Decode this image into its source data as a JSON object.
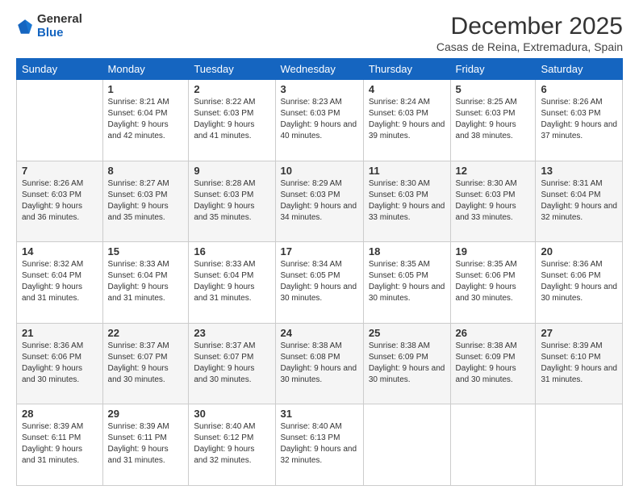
{
  "header": {
    "logo_general": "General",
    "logo_blue": "Blue",
    "main_title": "December 2025",
    "subtitle": "Casas de Reina, Extremadura, Spain"
  },
  "days_of_week": [
    "Sunday",
    "Monday",
    "Tuesday",
    "Wednesday",
    "Thursday",
    "Friday",
    "Saturday"
  ],
  "weeks": [
    [
      {
        "day": "",
        "sunrise": "",
        "sunset": "",
        "daylight": ""
      },
      {
        "day": "1",
        "sunrise": "Sunrise: 8:21 AM",
        "sunset": "Sunset: 6:04 PM",
        "daylight": "Daylight: 9 hours and 42 minutes."
      },
      {
        "day": "2",
        "sunrise": "Sunrise: 8:22 AM",
        "sunset": "Sunset: 6:03 PM",
        "daylight": "Daylight: 9 hours and 41 minutes."
      },
      {
        "day": "3",
        "sunrise": "Sunrise: 8:23 AM",
        "sunset": "Sunset: 6:03 PM",
        "daylight": "Daylight: 9 hours and 40 minutes."
      },
      {
        "day": "4",
        "sunrise": "Sunrise: 8:24 AM",
        "sunset": "Sunset: 6:03 PM",
        "daylight": "Daylight: 9 hours and 39 minutes."
      },
      {
        "day": "5",
        "sunrise": "Sunrise: 8:25 AM",
        "sunset": "Sunset: 6:03 PM",
        "daylight": "Daylight: 9 hours and 38 minutes."
      },
      {
        "day": "6",
        "sunrise": "Sunrise: 8:26 AM",
        "sunset": "Sunset: 6:03 PM",
        "daylight": "Daylight: 9 hours and 37 minutes."
      }
    ],
    [
      {
        "day": "7",
        "sunrise": "Sunrise: 8:26 AM",
        "sunset": "Sunset: 6:03 PM",
        "daylight": "Daylight: 9 hours and 36 minutes."
      },
      {
        "day": "8",
        "sunrise": "Sunrise: 8:27 AM",
        "sunset": "Sunset: 6:03 PM",
        "daylight": "Daylight: 9 hours and 35 minutes."
      },
      {
        "day": "9",
        "sunrise": "Sunrise: 8:28 AM",
        "sunset": "Sunset: 6:03 PM",
        "daylight": "Daylight: 9 hours and 35 minutes."
      },
      {
        "day": "10",
        "sunrise": "Sunrise: 8:29 AM",
        "sunset": "Sunset: 6:03 PM",
        "daylight": "Daylight: 9 hours and 34 minutes."
      },
      {
        "day": "11",
        "sunrise": "Sunrise: 8:30 AM",
        "sunset": "Sunset: 6:03 PM",
        "daylight": "Daylight: 9 hours and 33 minutes."
      },
      {
        "day": "12",
        "sunrise": "Sunrise: 8:30 AM",
        "sunset": "Sunset: 6:03 PM",
        "daylight": "Daylight: 9 hours and 33 minutes."
      },
      {
        "day": "13",
        "sunrise": "Sunrise: 8:31 AM",
        "sunset": "Sunset: 6:04 PM",
        "daylight": "Daylight: 9 hours and 32 minutes."
      }
    ],
    [
      {
        "day": "14",
        "sunrise": "Sunrise: 8:32 AM",
        "sunset": "Sunset: 6:04 PM",
        "daylight": "Daylight: 9 hours and 31 minutes."
      },
      {
        "day": "15",
        "sunrise": "Sunrise: 8:33 AM",
        "sunset": "Sunset: 6:04 PM",
        "daylight": "Daylight: 9 hours and 31 minutes."
      },
      {
        "day": "16",
        "sunrise": "Sunrise: 8:33 AM",
        "sunset": "Sunset: 6:04 PM",
        "daylight": "Daylight: 9 hours and 31 minutes."
      },
      {
        "day": "17",
        "sunrise": "Sunrise: 8:34 AM",
        "sunset": "Sunset: 6:05 PM",
        "daylight": "Daylight: 9 hours and 30 minutes."
      },
      {
        "day": "18",
        "sunrise": "Sunrise: 8:35 AM",
        "sunset": "Sunset: 6:05 PM",
        "daylight": "Daylight: 9 hours and 30 minutes."
      },
      {
        "day": "19",
        "sunrise": "Sunrise: 8:35 AM",
        "sunset": "Sunset: 6:06 PM",
        "daylight": "Daylight: 9 hours and 30 minutes."
      },
      {
        "day": "20",
        "sunrise": "Sunrise: 8:36 AM",
        "sunset": "Sunset: 6:06 PM",
        "daylight": "Daylight: 9 hours and 30 minutes."
      }
    ],
    [
      {
        "day": "21",
        "sunrise": "Sunrise: 8:36 AM",
        "sunset": "Sunset: 6:06 PM",
        "daylight": "Daylight: 9 hours and 30 minutes."
      },
      {
        "day": "22",
        "sunrise": "Sunrise: 8:37 AM",
        "sunset": "Sunset: 6:07 PM",
        "daylight": "Daylight: 9 hours and 30 minutes."
      },
      {
        "day": "23",
        "sunrise": "Sunrise: 8:37 AM",
        "sunset": "Sunset: 6:07 PM",
        "daylight": "Daylight: 9 hours and 30 minutes."
      },
      {
        "day": "24",
        "sunrise": "Sunrise: 8:38 AM",
        "sunset": "Sunset: 6:08 PM",
        "daylight": "Daylight: 9 hours and 30 minutes."
      },
      {
        "day": "25",
        "sunrise": "Sunrise: 8:38 AM",
        "sunset": "Sunset: 6:09 PM",
        "daylight": "Daylight: 9 hours and 30 minutes."
      },
      {
        "day": "26",
        "sunrise": "Sunrise: 8:38 AM",
        "sunset": "Sunset: 6:09 PM",
        "daylight": "Daylight: 9 hours and 30 minutes."
      },
      {
        "day": "27",
        "sunrise": "Sunrise: 8:39 AM",
        "sunset": "Sunset: 6:10 PM",
        "daylight": "Daylight: 9 hours and 31 minutes."
      }
    ],
    [
      {
        "day": "28",
        "sunrise": "Sunrise: 8:39 AM",
        "sunset": "Sunset: 6:11 PM",
        "daylight": "Daylight: 9 hours and 31 minutes."
      },
      {
        "day": "29",
        "sunrise": "Sunrise: 8:39 AM",
        "sunset": "Sunset: 6:11 PM",
        "daylight": "Daylight: 9 hours and 31 minutes."
      },
      {
        "day": "30",
        "sunrise": "Sunrise: 8:40 AM",
        "sunset": "Sunset: 6:12 PM",
        "daylight": "Daylight: 9 hours and 32 minutes."
      },
      {
        "day": "31",
        "sunrise": "Sunrise: 8:40 AM",
        "sunset": "Sunset: 6:13 PM",
        "daylight": "Daylight: 9 hours and 32 minutes."
      },
      {
        "day": "",
        "sunrise": "",
        "sunset": "",
        "daylight": ""
      },
      {
        "day": "",
        "sunrise": "",
        "sunset": "",
        "daylight": ""
      },
      {
        "day": "",
        "sunrise": "",
        "sunset": "",
        "daylight": ""
      }
    ]
  ]
}
